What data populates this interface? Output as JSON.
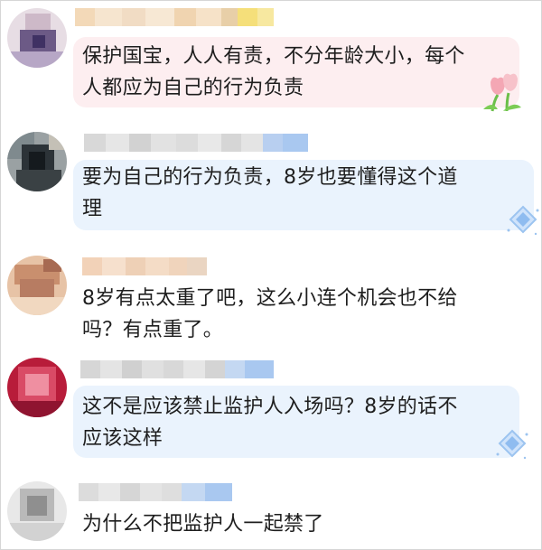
{
  "comments": [
    {
      "text_line1": "保护国宝，人人有责，不分年龄大小，每个",
      "text_line2": "人都应为自己的行为负责",
      "avatar_colors": [
        "#d8c6d0",
        "#5e4b7e",
        "#b9a8c9",
        "#eee7ee"
      ],
      "badge": "flower"
    },
    {
      "text_line1": "要为自己的行为负责，8岁也要懂得这个道",
      "text_line2": "理",
      "avatar_colors": [
        "#4a5a63",
        "#1f2429",
        "#8a8e8a",
        "#c9c2b4"
      ],
      "badge": "gem"
    },
    {
      "text_line1": "8岁有点太重了吧，这么小连个机会也不给",
      "text_line2": "吗？有点重了。",
      "avatar_colors": [
        "#d9a98c",
        "#b07a62",
        "#e8c5a8",
        "#f3ddc9"
      ],
      "badge": ""
    },
    {
      "text_line1": "这不是应该禁止监护人入场吗？8岁的话不",
      "text_line2": "应该这样",
      "avatar_colors": [
        "#c21f3d",
        "#e2697d",
        "#a01632",
        "#f2b4bf"
      ],
      "badge": "gem"
    },
    {
      "text_line1": "为什么不把监护人一起禁了",
      "text_line2": "",
      "avatar_colors": [
        "#bdbdbd",
        "#9e9e9e",
        "#d9d9d9",
        "#eeeeee"
      ],
      "badge": ""
    }
  ],
  "colors": {
    "bubble_pink": "#fdeef0",
    "bubble_blue": "#eaf3fd",
    "text": "#1e1e1e",
    "blur_blue": "#a9c8f0"
  },
  "icons": [
    "avatar-blurred",
    "tulip-flower-icon",
    "diamond-gem-icon"
  ]
}
